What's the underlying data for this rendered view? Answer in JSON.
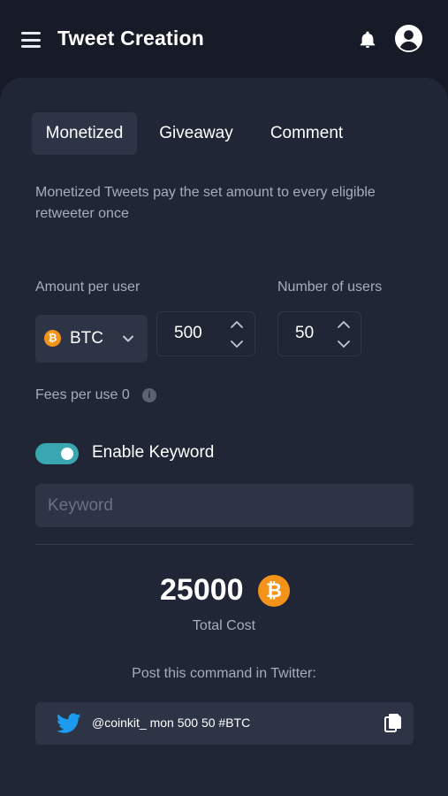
{
  "header": {
    "title": "Tweet Creation"
  },
  "tabs": [
    {
      "label": "Monetized",
      "active": true
    },
    {
      "label": "Giveaway",
      "active": false
    },
    {
      "label": "Comment",
      "active": false
    }
  ],
  "description": "Monetized Tweets pay the set amount to every eligible retweeter once",
  "amount": {
    "label": "Amount per user",
    "currency": "BTC",
    "currency_symbol": "₿",
    "value": "500"
  },
  "users": {
    "label": "Number of users",
    "value": "50"
  },
  "fees": {
    "text": "Fees per use 0",
    "info_symbol": "i"
  },
  "keyword": {
    "toggle_label": "Enable Keyword",
    "enabled": true,
    "placeholder": "Keyword",
    "value": ""
  },
  "total": {
    "value": "25000",
    "coin_symbol": "₿",
    "label": "Total Cost"
  },
  "command": {
    "label": "Post this command in Twitter:",
    "text": "@coinkit_ mon 500 50 #BTC"
  },
  "colors": {
    "background": "#161b27",
    "panel": "#202636",
    "accent_toggle": "#3aa6b0",
    "btc_orange": "#f4931a",
    "twitter_blue": "#1d9bf0"
  },
  "icons": [
    "menu-icon",
    "bell-icon",
    "account-icon",
    "chevron-down-icon",
    "stepper-icon",
    "info-icon",
    "twitter-icon",
    "copy-icon"
  ]
}
